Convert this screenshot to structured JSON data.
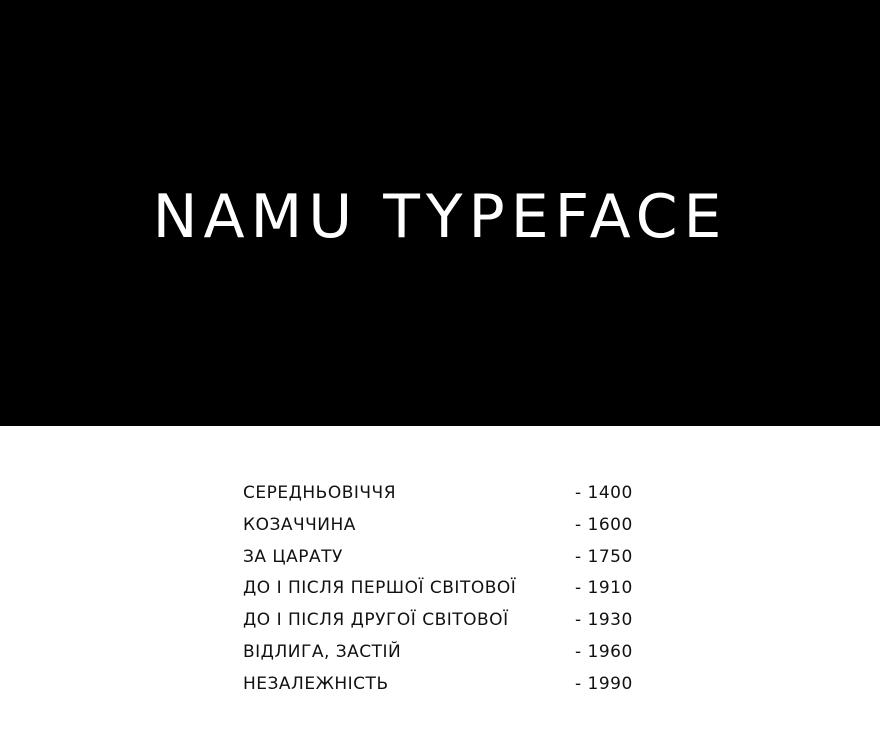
{
  "hero": {
    "title": "NAMU TYPEFACE",
    "background_color": "#000000",
    "text_color": "#ffffff"
  },
  "periods": [
    {
      "name": "Середньовіччя",
      "year": "- 1400"
    },
    {
      "name": "Козаччина",
      "year": "- 1600"
    },
    {
      "name": "За царату",
      "year": "- 1750"
    },
    {
      "name": "До і після Першої світової",
      "year": "- 1910"
    },
    {
      "name": "До і після Другої світової",
      "year": "- 1930"
    },
    {
      "name": "Відлига, застій",
      "year": "- 1960"
    },
    {
      "name": "Незалежність",
      "year": "- 1990"
    }
  ]
}
